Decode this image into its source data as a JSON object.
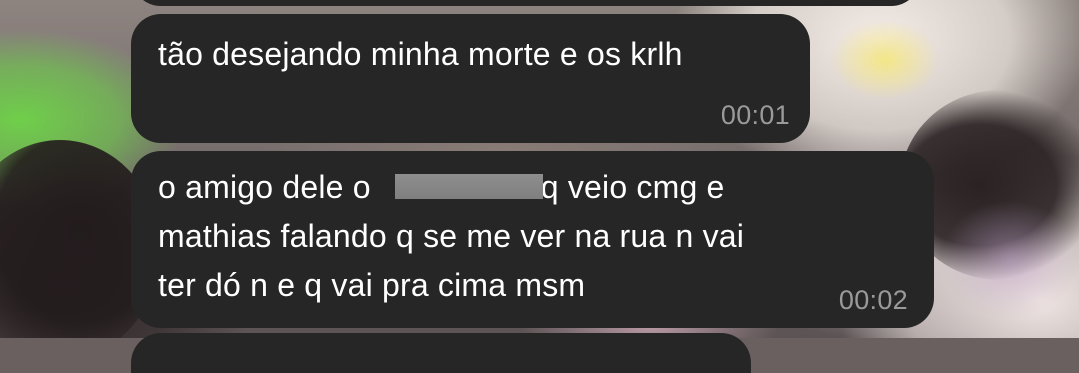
{
  "chat": {
    "messages": [
      {
        "text": "tão desejando minha morte e os krlh",
        "time": "00:01"
      },
      {
        "line1_before": "o amigo dele o",
        "line1_after": "oq veio cmg e",
        "line2": "mathias falando q se me ver na rua n vai",
        "line3": "ter dó n e q vai pra cima msm",
        "time": "00:02",
        "redacted": true
      }
    ]
  },
  "colors": {
    "bubble_background": "#262626",
    "message_text": "#ffffff",
    "timestamp_text": "#9a9a9a",
    "redaction_block": "#8a8a8a"
  }
}
